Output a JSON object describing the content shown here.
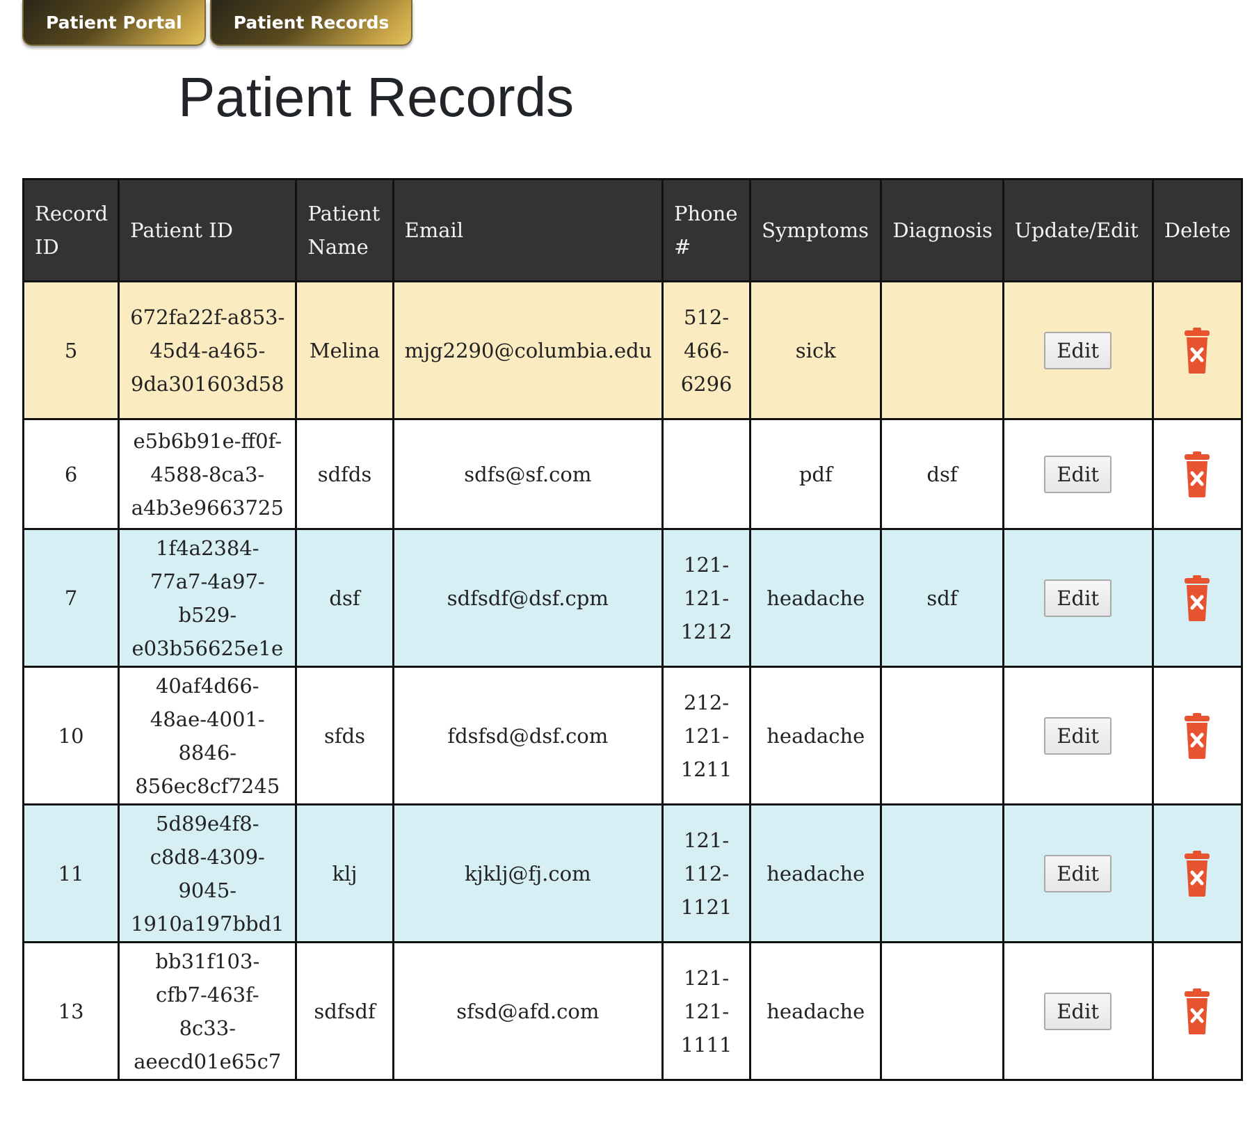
{
  "nav": {
    "tabs": [
      {
        "label": "Patient Portal"
      },
      {
        "label": "Patient Records"
      }
    ]
  },
  "page": {
    "title": "Patient Records"
  },
  "table": {
    "columns": [
      "Record ID",
      "Patient ID",
      "Patient Name",
      "Email",
      "Phone #",
      "Symptoms",
      "Diagnosis",
      "Update/Edit",
      "Delete"
    ],
    "edit_label": "Edit",
    "rows": [
      {
        "record_id": "5",
        "patient_id": "672fa22f-a853-45d4-a465-9da301603d58",
        "name": "Melina",
        "email": "mjg2290@columbia.edu",
        "phone": "512-466-6296",
        "symptoms": "sick",
        "diagnosis": "",
        "bg": "yellow"
      },
      {
        "record_id": "6",
        "patient_id": "e5b6b91e-ff0f-4588-8ca3-a4b3e9663725",
        "name": "sdfds",
        "email": "sdfs@sf.com",
        "phone": "",
        "symptoms": "pdf",
        "diagnosis": "dsf",
        "bg": "white"
      },
      {
        "record_id": "7",
        "patient_id": "1f4a2384-77a7-4a97-b529-e03b56625e1e",
        "name": "dsf",
        "email": "sdfsdf@dsf.cpm",
        "phone": "121-121-1212",
        "symptoms": "headache",
        "diagnosis": "sdf",
        "bg": "blue"
      },
      {
        "record_id": "10",
        "patient_id": "40af4d66-48ae-4001-8846-856ec8cf7245",
        "name": "sfds",
        "email": "fdsfsd@dsf.com",
        "phone": "212-121-1211",
        "symptoms": "headache",
        "diagnosis": "",
        "bg": "white"
      },
      {
        "record_id": "11",
        "patient_id": "5d89e4f8-c8d8-4309-9045-1910a197bbd1",
        "name": "klj",
        "email": "kjklj@fj.com",
        "phone": "121-112-1121",
        "symptoms": "headache",
        "diagnosis": "",
        "bg": "blue"
      },
      {
        "record_id": "13",
        "patient_id": "bb31f103-cfb7-463f-8c33-aeecd01e65c7",
        "name": "sdfsdf",
        "email": "sfsd@afd.com",
        "phone": "121-121-1111",
        "symptoms": "headache",
        "diagnosis": "",
        "bg": "white"
      }
    ]
  },
  "colors": {
    "header_bg": "#333333",
    "row_yellow": "#faebc0",
    "row_blue": "#d5eff5",
    "trash_icon": "#e8532f"
  },
  "icons": {
    "delete": "trash-icon"
  }
}
